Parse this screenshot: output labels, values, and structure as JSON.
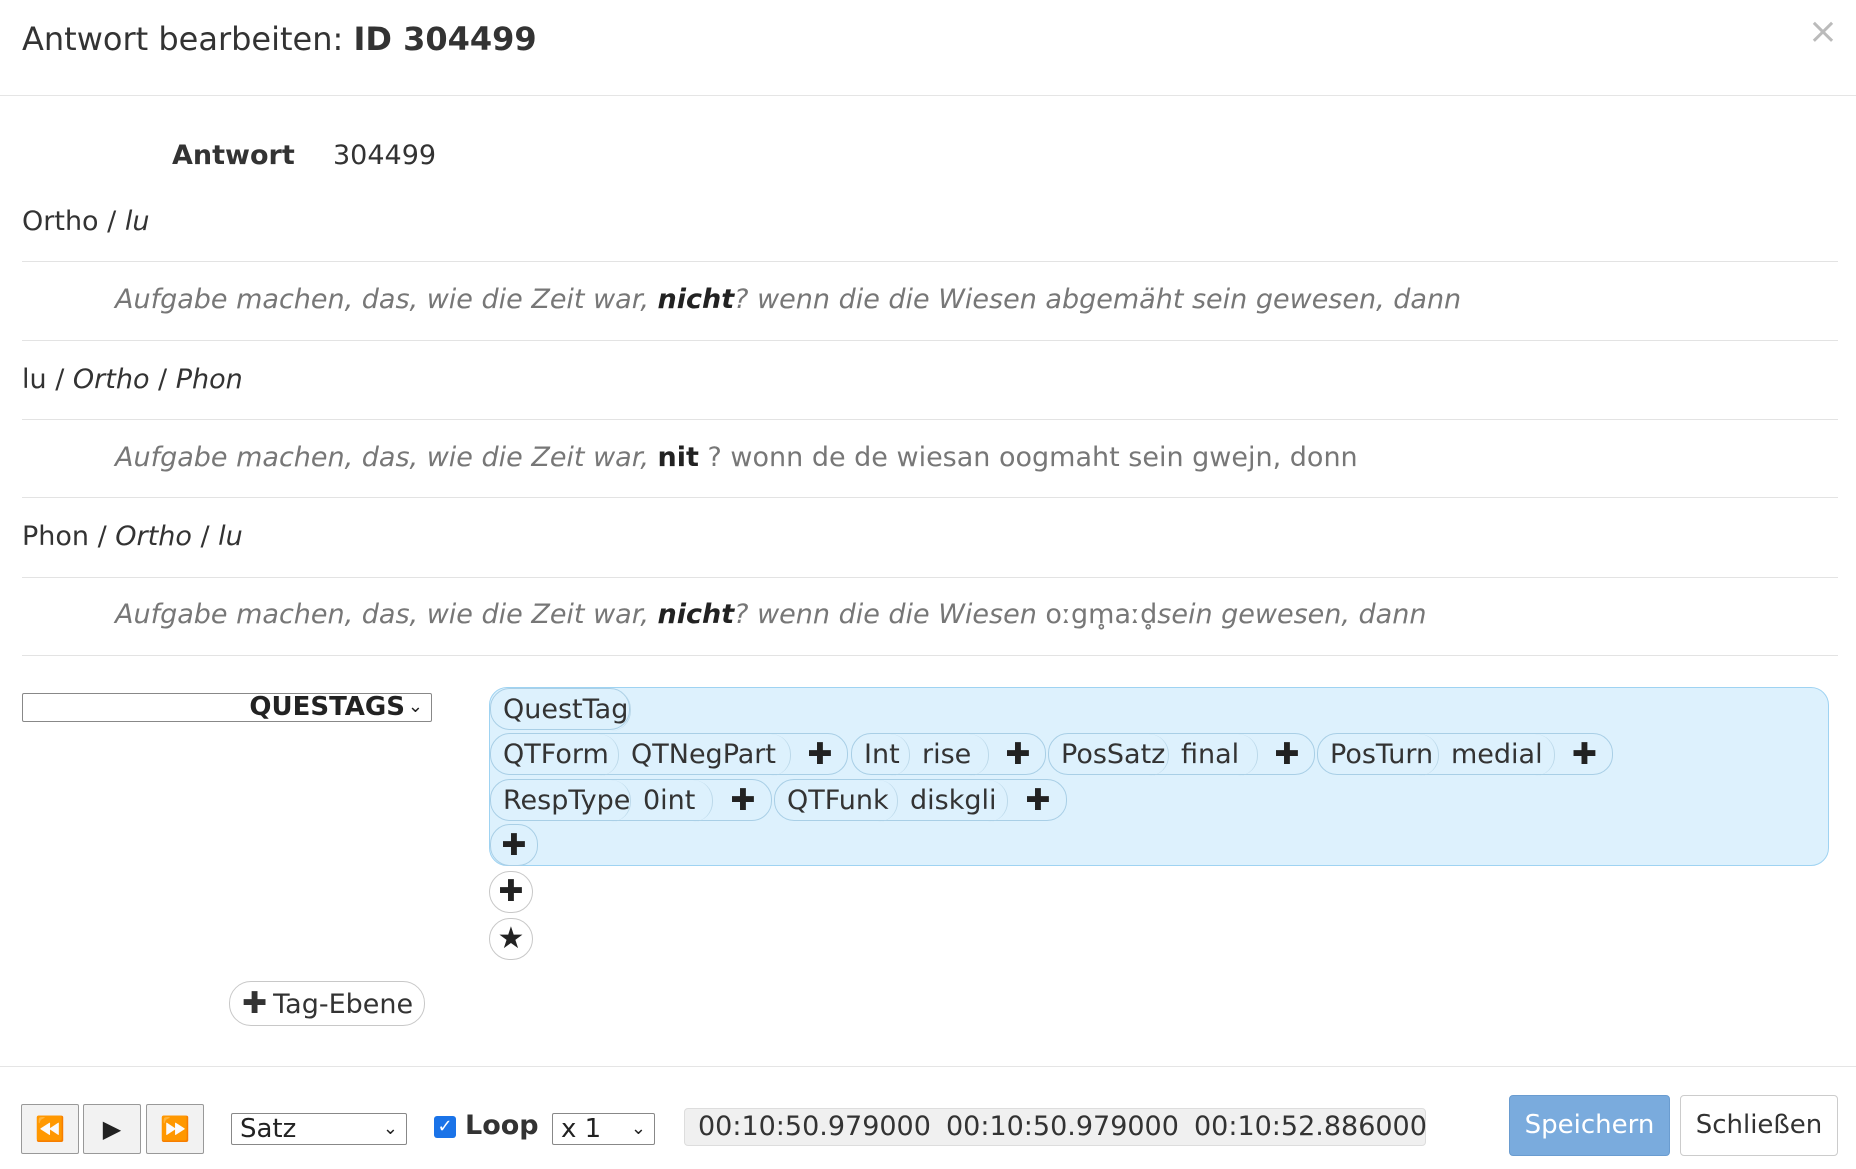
{
  "header": {
    "title_prefix": "Antwort bearbeiten:",
    "title_id": "ID 304499",
    "close_symbol": "×"
  },
  "antwort": {
    "label": "Antwort",
    "value": "304499"
  },
  "sections": [
    {
      "head_main": "Ortho",
      "head_sep1": " / ",
      "head_it1": "lu",
      "head_sep2": "",
      "head_it2": "",
      "text_before": "Aufgabe machen, das, wie die Zeit war, ",
      "text_highlight": "nicht",
      "text_after": "? wenn die die Wiesen abgemäht sein gewesen, dann"
    },
    {
      "head_main": "lu",
      "head_sep1": " / ",
      "head_it1": "Ortho",
      "head_sep2": " / ",
      "head_it2": "Phon",
      "text_before": "Aufgabe machen, das, wie die Zeit war, ",
      "text_highlight": "nit",
      "text_after": " ? wonn de de wiesan oogmaht sein gwejn, donn"
    },
    {
      "head_main": "Phon",
      "head_sep1": " / ",
      "head_it1": "Ortho",
      "head_sep2": " / ",
      "head_it2": "lu",
      "text_before": "Aufgabe machen, das, wie die Zeit war, ",
      "text_highlight": "nicht",
      "text_after_1": "? wenn die die Wiesen ",
      "text_phon": "oːgm̥aːd̥",
      "text_after_2": "sein gewesen, dann"
    }
  ],
  "tag_layer_select": {
    "value": "QUESTAGS"
  },
  "tag_panel": {
    "root": "QuestTag",
    "groups": [
      {
        "tags": [
          "QTForm",
          "QTNegPart"
        ]
      },
      {
        "tags": [
          "Int",
          "rise"
        ]
      },
      {
        "tags": [
          "PosSatz",
          "final"
        ]
      },
      {
        "tags": [
          "PosTurn",
          "medial"
        ]
      },
      {
        "tags": [
          "RespType",
          "0int"
        ]
      },
      {
        "tags": [
          "QTFunk",
          "diskgli"
        ]
      }
    ]
  },
  "icons": {
    "plus": "✚",
    "star": "★",
    "rewind": "⏪",
    "play": "▶",
    "forward": "⏩",
    "check": "✓",
    "chevron": "⌄"
  },
  "add_layer_button": {
    "label": "Tag-Ebene"
  },
  "player": {
    "unit_select": "Satz",
    "loop_label": "Loop",
    "loop_checked": true,
    "speed_select": "x 1",
    "times": [
      "00:10:50.979000",
      "00:10:50.979000",
      "00:10:52.886000"
    ]
  },
  "actions": {
    "save_label": "Speichern",
    "close_label": "Schließen"
  }
}
